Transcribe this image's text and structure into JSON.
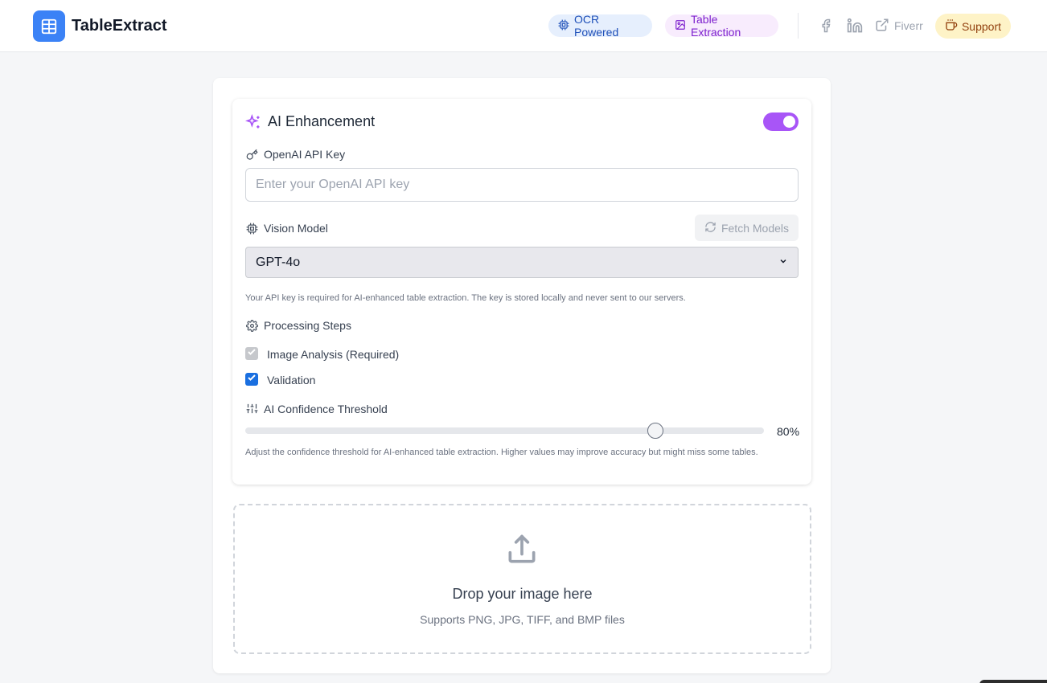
{
  "header": {
    "brand": "TableExtract",
    "badges": [
      {
        "label": "OCR Powered",
        "icon": "cpu-icon",
        "color": "#1e4fb8"
      },
      {
        "label": "Table Extraction",
        "icon": "image-icon",
        "color": "#7e22ce"
      }
    ],
    "links": {
      "facebook_icon": "facebook-icon",
      "linkedin_icon": "linkedin-icon",
      "fiverr_label": "Fiverr",
      "support_label": "Support"
    }
  },
  "ai": {
    "title": "AI Enhancement",
    "enabled": true,
    "accent": "#a855f7",
    "api_key_label": "OpenAI API Key",
    "api_key_value": "",
    "api_key_placeholder": "Enter your OpenAI API key",
    "vision_model_label": "Vision Model",
    "fetch_models_label": "Fetch Models",
    "selected_model": "GPT-4o",
    "api_help": "Your API key is required for AI-enhanced table extraction. The key is stored locally and never sent to our servers.",
    "processing_label": "Processing Steps",
    "steps": [
      {
        "label": "Image Analysis (Required)",
        "checked": true,
        "disabled": true
      },
      {
        "label": "Validation",
        "checked": true,
        "disabled": false
      }
    ],
    "threshold_label": "AI Confidence Threshold",
    "threshold_value": 80,
    "threshold_display": "80%",
    "threshold_help": "Adjust the confidence threshold for AI-enhanced table extraction. Higher values may improve accuracy but might miss some tables."
  },
  "dropzone": {
    "title": "Drop your image here",
    "subtitle": "Supports PNG, JPG, TIFF, and BMP files"
  }
}
